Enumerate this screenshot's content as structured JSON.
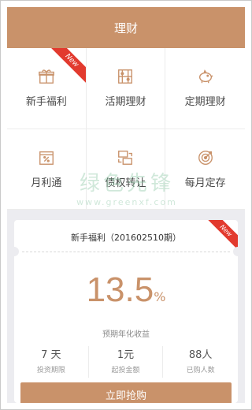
{
  "header": {
    "title": "理财"
  },
  "grid": [
    {
      "label": "新手福利",
      "icon": "gift-icon",
      "badge": "New"
    },
    {
      "label": "活期理财",
      "icon": "abacus-icon",
      "badge": ""
    },
    {
      "label": "定期理财",
      "icon": "piggy-bank-icon",
      "badge": ""
    },
    {
      "label": "月利通",
      "icon": "percent-calendar-icon",
      "badge": ""
    },
    {
      "label": "债权转让",
      "icon": "transfer-icon",
      "badge": ""
    },
    {
      "label": "每月定存",
      "icon": "target-icon",
      "badge": ""
    }
  ],
  "watermark": {
    "text": "绿色先锋",
    "sub": "www.greenxf.com"
  },
  "product": {
    "title": "新手福利（201602510期）",
    "badge": "New",
    "rate": "13.5",
    "rate_unit": "%",
    "rate_label": "预期年化收益",
    "stats": [
      {
        "value": "7 天",
        "label": "投资期限"
      },
      {
        "value": "1元",
        "label": "起投金额"
      },
      {
        "value": "88人",
        "label": "已购人数"
      }
    ],
    "button": "立即抢购"
  },
  "colors": {
    "accent": "#c9926a",
    "badge": "#e23a2e"
  }
}
